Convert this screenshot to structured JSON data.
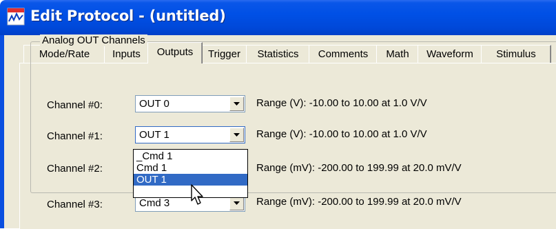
{
  "window": {
    "title": "Edit Protocol - (untitled)"
  },
  "tabs": [
    {
      "label": "Mode/Rate"
    },
    {
      "label": "Inputs"
    },
    {
      "label": "Outputs"
    },
    {
      "label": "Trigger"
    },
    {
      "label": "Statistics"
    },
    {
      "label": "Comments"
    },
    {
      "label": "Math"
    },
    {
      "label": "Waveform"
    },
    {
      "label": "Stimulus"
    }
  ],
  "active_tab": "Outputs",
  "group": {
    "title": "Analog OUT Channels",
    "channels": [
      {
        "label": "Channel #0:",
        "value": "OUT 0",
        "range": "Range (V): -10.00 to 10.00 at 1.0 V/V"
      },
      {
        "label": "Channel #1:",
        "value": "OUT 1",
        "range": "Range (V): -10.00 to 10.00 at 1.0 V/V"
      },
      {
        "label": "Channel #2:",
        "value": "",
        "range": "Range (mV): -200.00 to 199.99 at 20.0 mV/V"
      },
      {
        "label": "Channel #3:",
        "value": "Cmd 3",
        "range": "Range (mV): -200.00 to 199.99 at 20.0 mV/V"
      }
    ]
  },
  "dropdown": {
    "options": [
      "_Cmd 1",
      "Cmd 1",
      "OUT 1"
    ],
    "selected": "OUT 1"
  },
  "colors": {
    "titlebar": "#0050e6",
    "face": "#ece9d8",
    "selection": "#316ac5"
  }
}
